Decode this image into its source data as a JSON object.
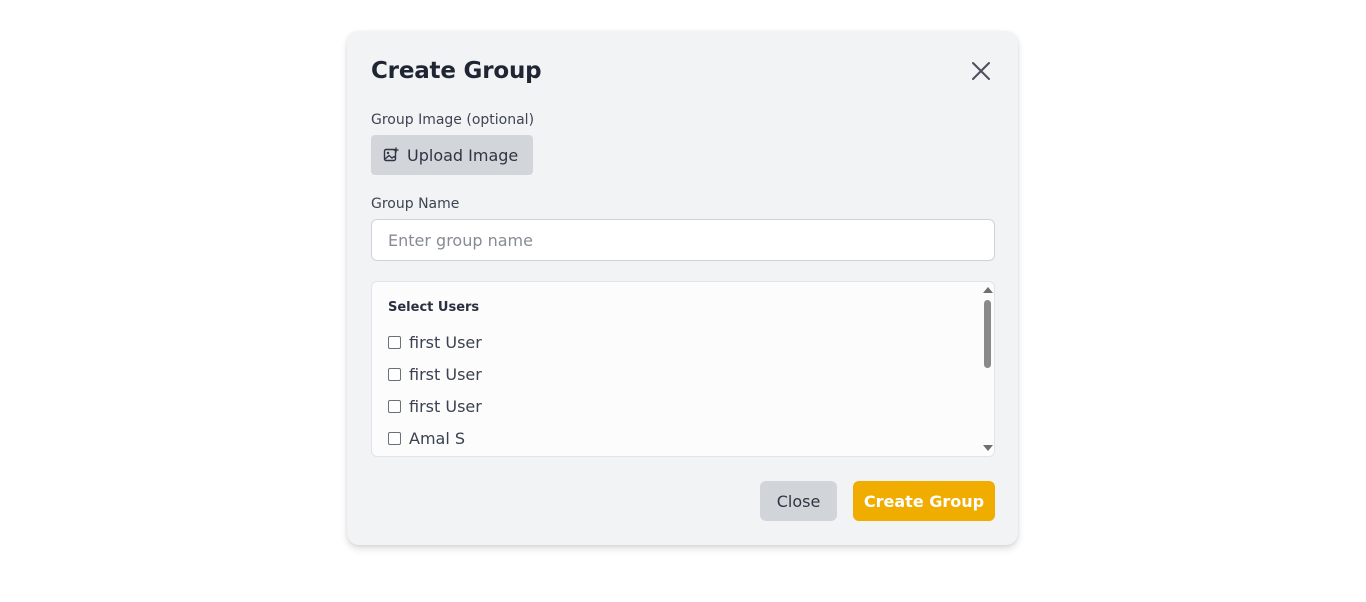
{
  "modal": {
    "title": "Create Group",
    "image_label": "Group Image (optional)",
    "upload_button": "Upload Image",
    "name_label": "Group Name",
    "name_input": {
      "value": "",
      "placeholder": "Enter group name"
    },
    "users": {
      "heading": "Select Users",
      "items": [
        {
          "label": "first User",
          "checked": false
        },
        {
          "label": "first User",
          "checked": false
        },
        {
          "label": "first User",
          "checked": false
        },
        {
          "label": "Amal S",
          "checked": false
        }
      ]
    },
    "close_button": "Close",
    "create_button": "Create Group"
  },
  "colors": {
    "accent": "#f0ad00",
    "modal_background": "#f2f3f5",
    "secondary_button": "#d1d4d9"
  },
  "icons": {
    "close": "close-icon",
    "upload": "image-plus-icon"
  }
}
